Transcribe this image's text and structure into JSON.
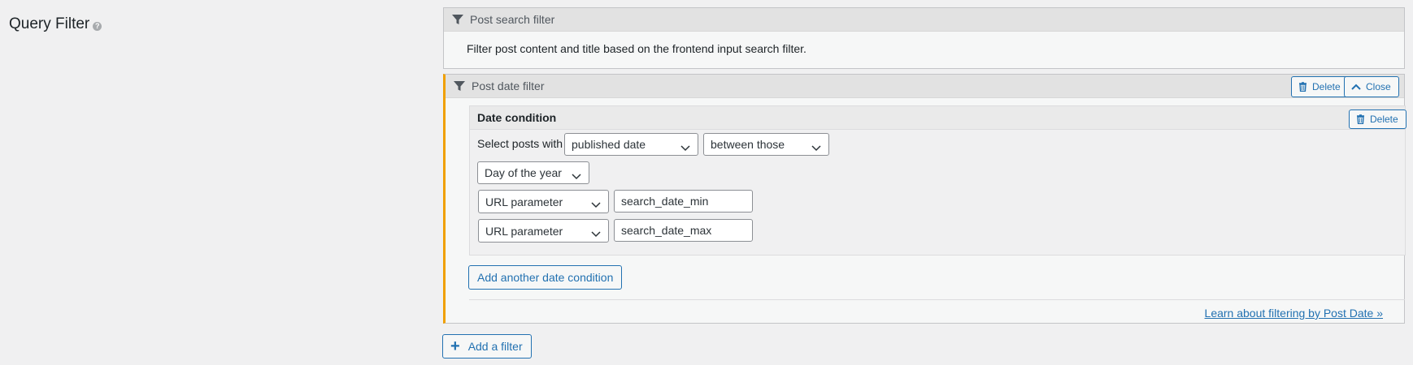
{
  "section": {
    "title": "Query Filter",
    "help_icon": "question-icon"
  },
  "filters": [
    {
      "title": "Post search filter",
      "icon": "filter-icon",
      "description": "Filter post content and title based on the frontend input search filter."
    },
    {
      "title": "Post date filter",
      "icon": "filter-icon",
      "delete_label": "Delete",
      "close_label": "Close",
      "condition": {
        "title": "Date condition",
        "delete_label": "Delete",
        "select_label": "Select posts with",
        "date_field": "published date",
        "comparison": "between those",
        "granularity": "Day of the year",
        "min": {
          "source": "URL parameter",
          "value": "search_date_min"
        },
        "max": {
          "source": "URL parameter",
          "value": "search_date_max"
        }
      },
      "add_condition_label": "Add another date condition",
      "learn_link": "Learn about filtering by Post Date »"
    }
  ],
  "add_filter_label": "Add a filter",
  "colors": {
    "accent": "#2271b1",
    "active_border": "#f0a000"
  }
}
